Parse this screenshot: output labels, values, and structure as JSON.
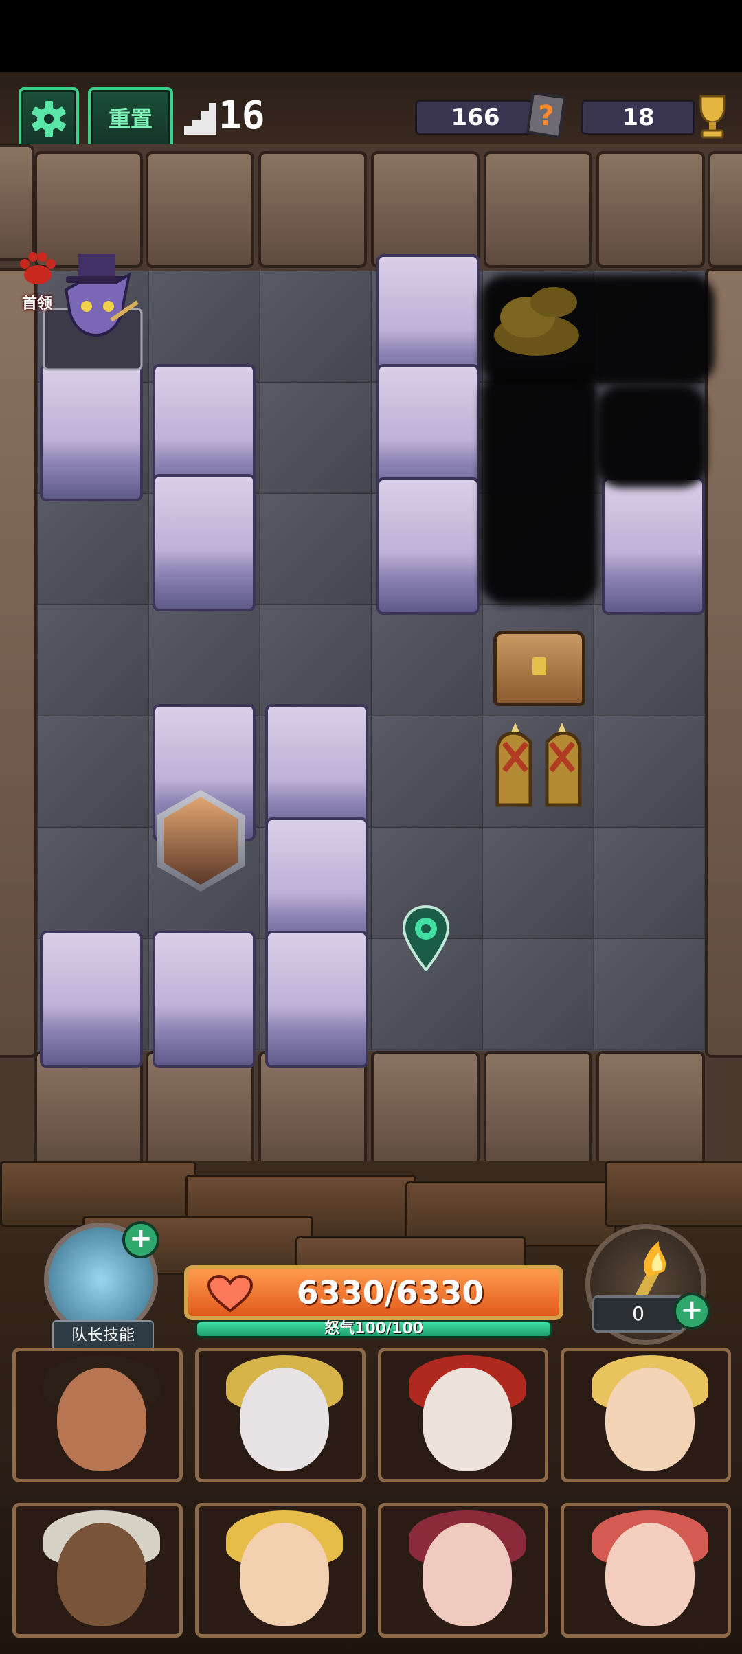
{
  "header": {
    "reset_label": "重置",
    "floor": "16",
    "keys": "166",
    "trophies": "18"
  },
  "board": {
    "boss_label": "首领"
  },
  "team": {
    "captain_skill_label": "队长技能",
    "hp": "6330/6330",
    "rage": "怒气100/100",
    "torch_count": "0"
  },
  "colors": {
    "accent_green": "#3bd08a",
    "hp_orange": "#e05a1c",
    "rage_green": "#3fe0a0",
    "rock_purple": "#bfb1d6"
  },
  "icons": [
    "settings-gear-icon",
    "stairs-icon",
    "keystone-icon",
    "trophy-icon",
    "heart-icon",
    "torch-icon",
    "plus-icon",
    "map-marker-icon"
  ]
}
